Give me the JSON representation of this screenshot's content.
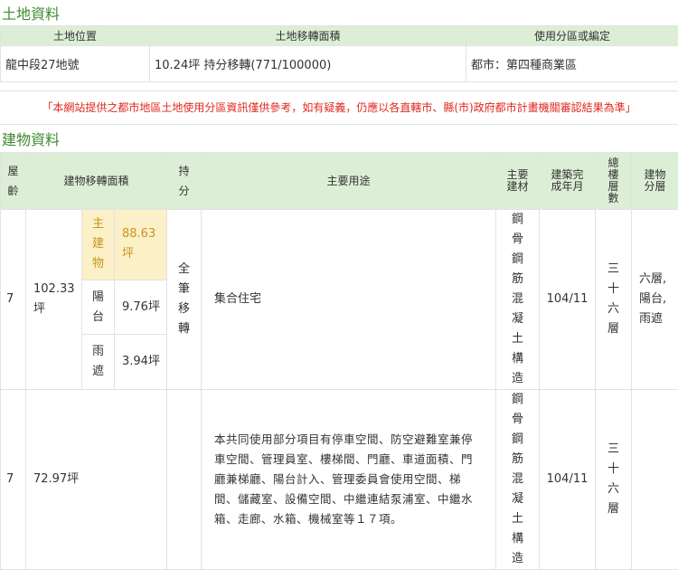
{
  "land": {
    "title": "土地資料",
    "headers": [
      "土地位置",
      "土地移轉面積",
      "使用分區或編定"
    ],
    "row": {
      "location": "龍中段27地號",
      "area": "10.24坪 持分移轉(771/100000)",
      "zoning": "都市：第四種商業區"
    }
  },
  "notice": "「本網站提供之都市地區土地使用分區資訊僅供參考，如有疑義，仍應以各直轄市、縣(市)政府都市計畫機關審認結果為準」",
  "building": {
    "title": "建物資料",
    "headers": {
      "age": "屋齡",
      "transfer_area": "建物移轉面積",
      "share": "持分",
      "purpose": "主要用途",
      "material": "主要建材",
      "completion": "建築完成年月",
      "total_floors": "總樓層數",
      "building_floors": "建物分層"
    },
    "rows": [
      {
        "age": "7",
        "area_total": "102.33坪",
        "sub": [
          {
            "label": "主建物",
            "value": "88.63坪"
          },
          {
            "label": "陽台",
            "value": "9.76坪"
          },
          {
            "label": "雨遮",
            "value": "3.94坪"
          }
        ],
        "share": "全筆移轉",
        "purpose": "集合住宅",
        "material": "鋼骨鋼筋混凝土構造",
        "completion": "104/11",
        "total_floors": "三十六層",
        "floors": "六層,陽台,雨遮"
      },
      {
        "age": "7",
        "area_total": "72.97坪",
        "purpose": "本共同使用部分項目有停車空間、防空避難室兼停車空間、管理員室、樓梯間、門廳、車道面積、門廳兼梯廳、陽台計入、管理委員會使用空間、梯間、儲藏室、設備空間、中繼連結泵浦室、中繼水箱、走廊、水箱、機械室等１７項。",
        "material": "鋼骨鋼筋混凝土構造",
        "completion": "104/11",
        "total_floors": "三十六層"
      }
    ]
  }
}
